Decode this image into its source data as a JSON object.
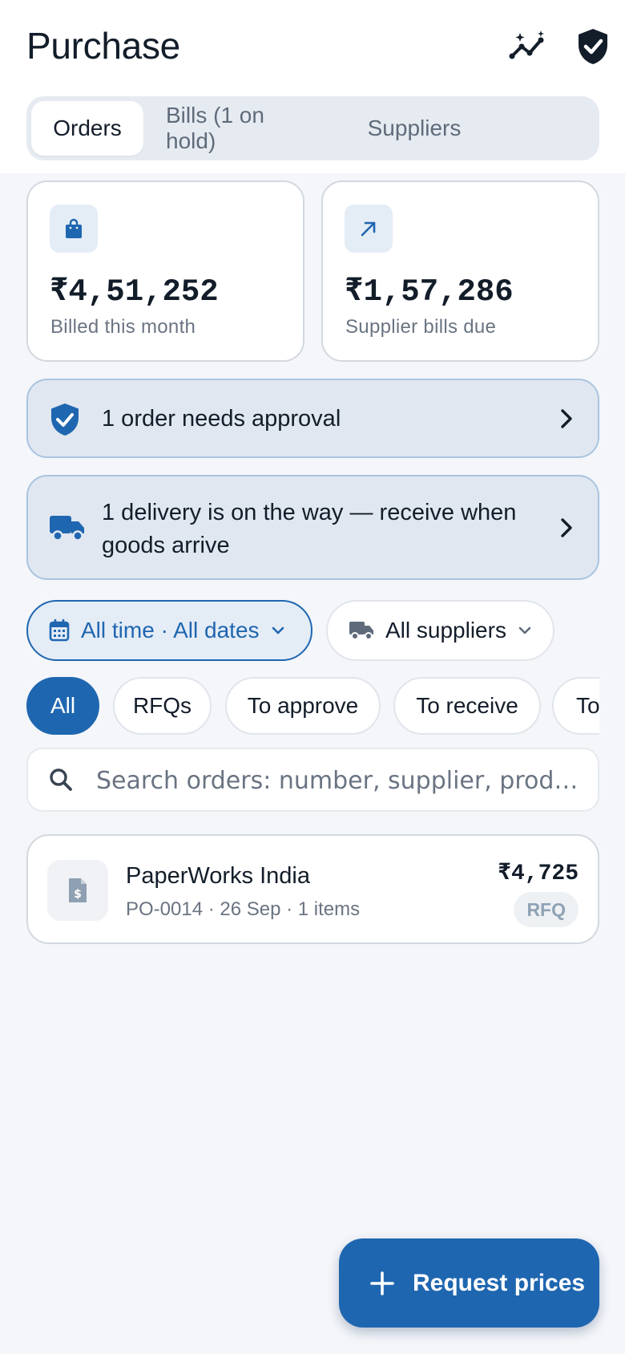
{
  "header": {
    "title": "Purchase",
    "insights_icon": "sparkle-trend-icon",
    "approval_icon": "shield-check-icon"
  },
  "tabs": [
    {
      "label": "Orders",
      "active": true
    },
    {
      "label": "Bills (1 on hold)",
      "active": false
    },
    {
      "label": "Suppliers",
      "active": false
    }
  ],
  "stats": [
    {
      "icon": "shopping-bag-icon",
      "value": "₹4,51,252",
      "label": "Billed this month"
    },
    {
      "icon": "arrow-up-right-icon",
      "value": "₹1,57,286",
      "label": "Supplier bills due"
    }
  ],
  "banners": {
    "approval": {
      "icon": "shield-check-icon",
      "text": "1 order needs approval"
    },
    "delivery": {
      "icon": "truck-icon",
      "line1": "1 delivery is on the way — receive when",
      "line2": "goods arrive"
    }
  },
  "filters": {
    "date": "All time · All dates",
    "supplier": "All suppliers"
  },
  "chips": [
    {
      "label": "All",
      "active": true
    },
    {
      "label": "RFQs",
      "active": false
    },
    {
      "label": "To approve",
      "active": false
    },
    {
      "label": "To receive",
      "active": false
    },
    {
      "label": "To",
      "active": false
    }
  ],
  "search": {
    "placeholder": "Search orders: number, supplier, prod…"
  },
  "orders": [
    {
      "supplier": "PaperWorks India",
      "meta": "PO-0014 · 26 Sep · 1 items",
      "amount": "₹4,725",
      "status": "RFQ"
    }
  ],
  "fab": {
    "label": "Request prices"
  },
  "colors": {
    "accent": "#1f66b0",
    "banner_bg": "#e0e7f0",
    "page_bg": "#f4f6fa"
  }
}
